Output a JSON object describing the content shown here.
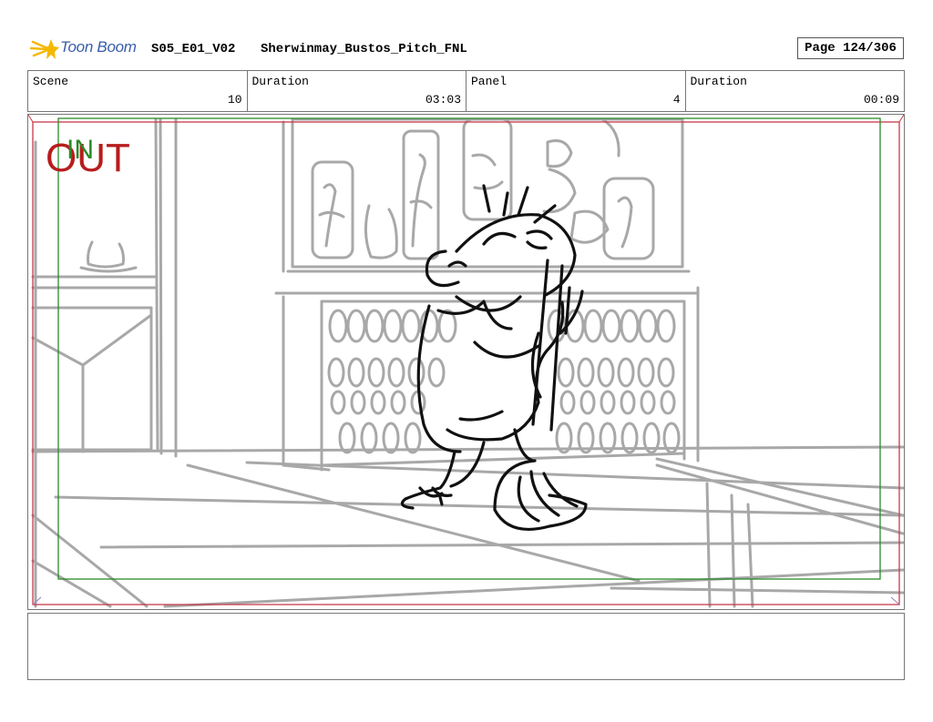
{
  "header": {
    "logo_text": "Toon Boom",
    "episode": "S05_E01_V02",
    "project": "Sherwinmay_Bustos_Pitch_FNL",
    "page": "Page 124/306"
  },
  "info": [
    {
      "label": "Scene",
      "value": "10"
    },
    {
      "label": "Duration",
      "value": "03:03"
    },
    {
      "label": "Panel",
      "value": "4"
    },
    {
      "label": "Duration",
      "value": "00:09"
    }
  ],
  "panel": {
    "in_label": "IN",
    "out_label": "OUT"
  },
  "colors": {
    "logo_yellow": "#f5b800",
    "logo_blue": "#3a5ea8",
    "in_green": "#2a8a2a",
    "out_red": "#b81c1c",
    "sketch_gray": "#a8a8a8"
  }
}
